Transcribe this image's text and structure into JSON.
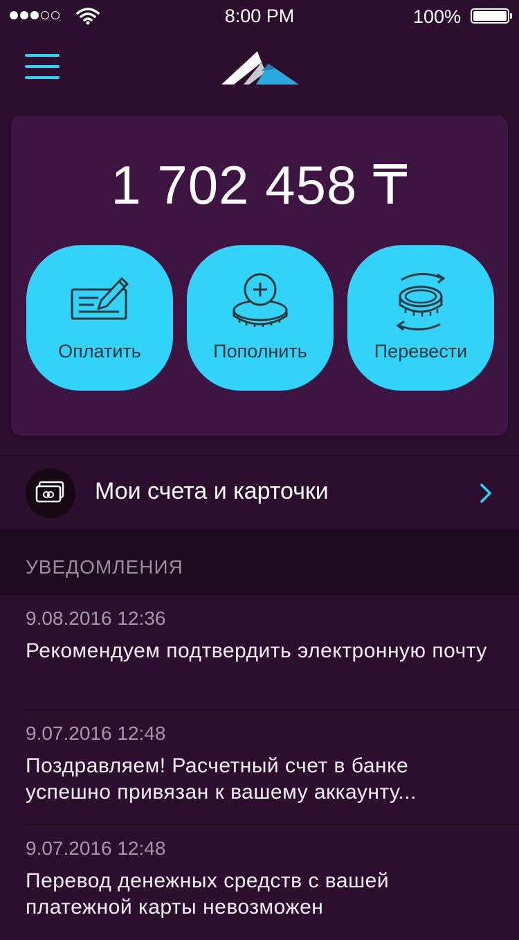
{
  "status_bar": {
    "time": "8:00 PM",
    "battery": "100%",
    "signal_bars_filled": 3,
    "signal_bars_total": 5
  },
  "header": {
    "menu_icon": "hamburger-menu-icon",
    "logo_icon": "mountain-logo-icon"
  },
  "balance": {
    "amount": "1 702 458 ₸"
  },
  "actions": [
    {
      "label": "Оплатить",
      "icon": "check-pen-icon"
    },
    {
      "label": "Пополнить",
      "icon": "coins-plus-icon"
    },
    {
      "label": "Перевести",
      "icon": "coin-transfer-icon"
    }
  ],
  "accounts": {
    "label": "Мои счета и карточки",
    "icon": "card-icon"
  },
  "notifications": {
    "title": "УВЕДОМЛЕНИЯ",
    "items": [
      {
        "date": "9.08.2016 12:36",
        "text": "Рекомендуем подтвердить электронную почту"
      },
      {
        "date": "9.07.2016 12:48",
        "text": "Поздравляем! Расчетный счет в банке успешно привязан к вашему аккаунту..."
      },
      {
        "date": "9.07.2016 12:48",
        "text": "Перевод денежных средств с вашей платежной карты невозможен"
      }
    ]
  },
  "colors": {
    "background": "#2c0f2f",
    "card": "#3e1442",
    "accent": "#33d3f9"
  }
}
